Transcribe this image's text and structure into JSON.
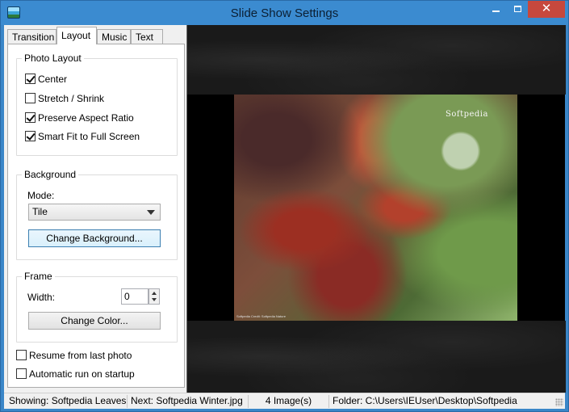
{
  "window": {
    "title": "Slide Show Settings"
  },
  "tabs": [
    {
      "label": "Transition",
      "active": false
    },
    {
      "label": "Layout",
      "active": true
    },
    {
      "label": "Music",
      "active": false
    },
    {
      "label": "Text",
      "active": false
    }
  ],
  "photo_layout": {
    "title": "Photo Layout",
    "options": [
      {
        "label": "Center",
        "checked": true
      },
      {
        "label": "Stretch / Shrink",
        "checked": false
      },
      {
        "label": "Preserve Aspect Ratio",
        "checked": true
      },
      {
        "label": "Smart Fit to Full Screen",
        "checked": true
      }
    ]
  },
  "background": {
    "title": "Background",
    "mode_label": "Mode:",
    "mode_value": "Tile",
    "change_button": "Change Background..."
  },
  "frame": {
    "title": "Frame",
    "width_label": "Width:",
    "width_value": "0",
    "change_color_button": "Change Color..."
  },
  "extra_options": [
    {
      "label": "Resume from last photo",
      "checked": false
    },
    {
      "label": "Automatic run on startup",
      "checked": false
    }
  ],
  "preview": {
    "watermark": "Softpedia",
    "credit": "Softpedia Credit: Softpedia Nature"
  },
  "status": {
    "showing": "Showing: Softpedia Leaves.j",
    "next": "Next: Softpedia Winter.jpg",
    "count": "4 Image(s)",
    "folder": "Folder: C:\\Users\\IEUser\\Desktop\\Softpedia"
  }
}
